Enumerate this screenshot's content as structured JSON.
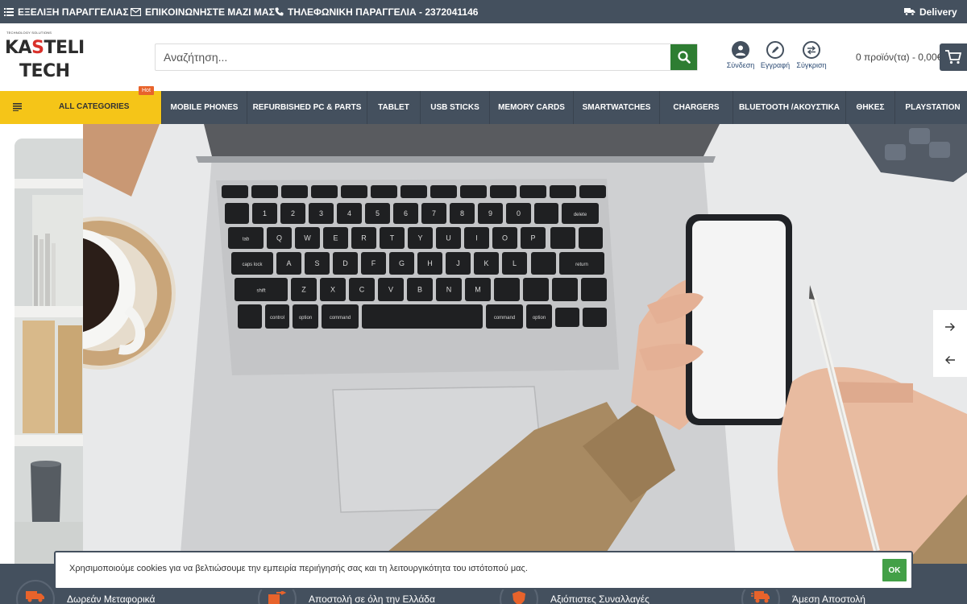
{
  "topbar": {
    "track_order": "ΕΞΕΛΙΞΗ ΠΑΡΑΓΓΕΛΙΑΣ",
    "contact": "ΕΠΙΚΟΙΝΩΝΗΣΤΕ ΜΑΖΙ ΜΑΣ",
    "phone_order": "ΤΗΛΕΦΩΝΙΚΗ ΠΑΡΑΓΓΕΛΙΑ - 2372041146",
    "delivery": "Delivery"
  },
  "logo": {
    "tagline": "TECHNOLOGY SOLUTIONS",
    "line1_a": "KA",
    "line1_b": "S",
    "line1_c": "TELI",
    "line2": "TECH"
  },
  "search": {
    "placeholder": "Αναζήτηση..."
  },
  "header_icons": {
    "login": "Σύνδεση",
    "register": "Εγγραφή",
    "compare": "Σύγκριση"
  },
  "cart": {
    "summary": "0 προϊόν(τα) - 0,00€"
  },
  "nav": {
    "all_categories": "ALL CATEGORIES",
    "hot_badge": "Hot",
    "items": [
      "MOBILE PHONES",
      "REFURBISHED PC & PARTS",
      "TABLET",
      "USB STICKS",
      "MEMORY CARDS",
      "SMARTWATCHES",
      "CHARGERS",
      "BLUETOOTH /ΑΚΟΥΣΤΙΚΑ",
      "ΘΗΚΕΣ",
      "PLAYSTATION"
    ]
  },
  "keyboard": {
    "row1": [
      "1",
      "2",
      "3",
      "4",
      "5",
      "6",
      "7",
      "8",
      "9",
      "0"
    ],
    "row2": [
      "Q",
      "W",
      "E",
      "R",
      "T",
      "Y",
      "U",
      "I",
      "O",
      "P"
    ],
    "row3": [
      "A",
      "S",
      "D",
      "F",
      "G",
      "H",
      "J",
      "K",
      "L"
    ],
    "row4": [
      "Z",
      "X",
      "C",
      "V",
      "B",
      "N",
      "M"
    ],
    "delete": "delete",
    "return": "return",
    "shift": "shift",
    "caps": "caps lock",
    "tab": "tab",
    "control": "control",
    "option": "option",
    "command": "command"
  },
  "features": {
    "items": [
      "Δωρεάν Μεταφορικά",
      "Αποστολή σε όλη την Ελλάδα",
      "Αξιόπιστες Συναλλαγές",
      "Άμεση Αποστολή"
    ]
  },
  "cookie": {
    "text": "Χρησιμοποιούμε cookies για να βελτιώσουμε την εμπειρία περιήγησής σας και τη λειτουργικότητα του ιστότοπού μας.",
    "ok": "OK"
  },
  "colors": {
    "topbar_bg": "#44505e",
    "accent_yellow": "#f5c518",
    "search_green": "#2e7d32",
    "hot_orange": "#e8632b",
    "feature_icon": "#e8632b",
    "ok_green": "#43a047"
  }
}
